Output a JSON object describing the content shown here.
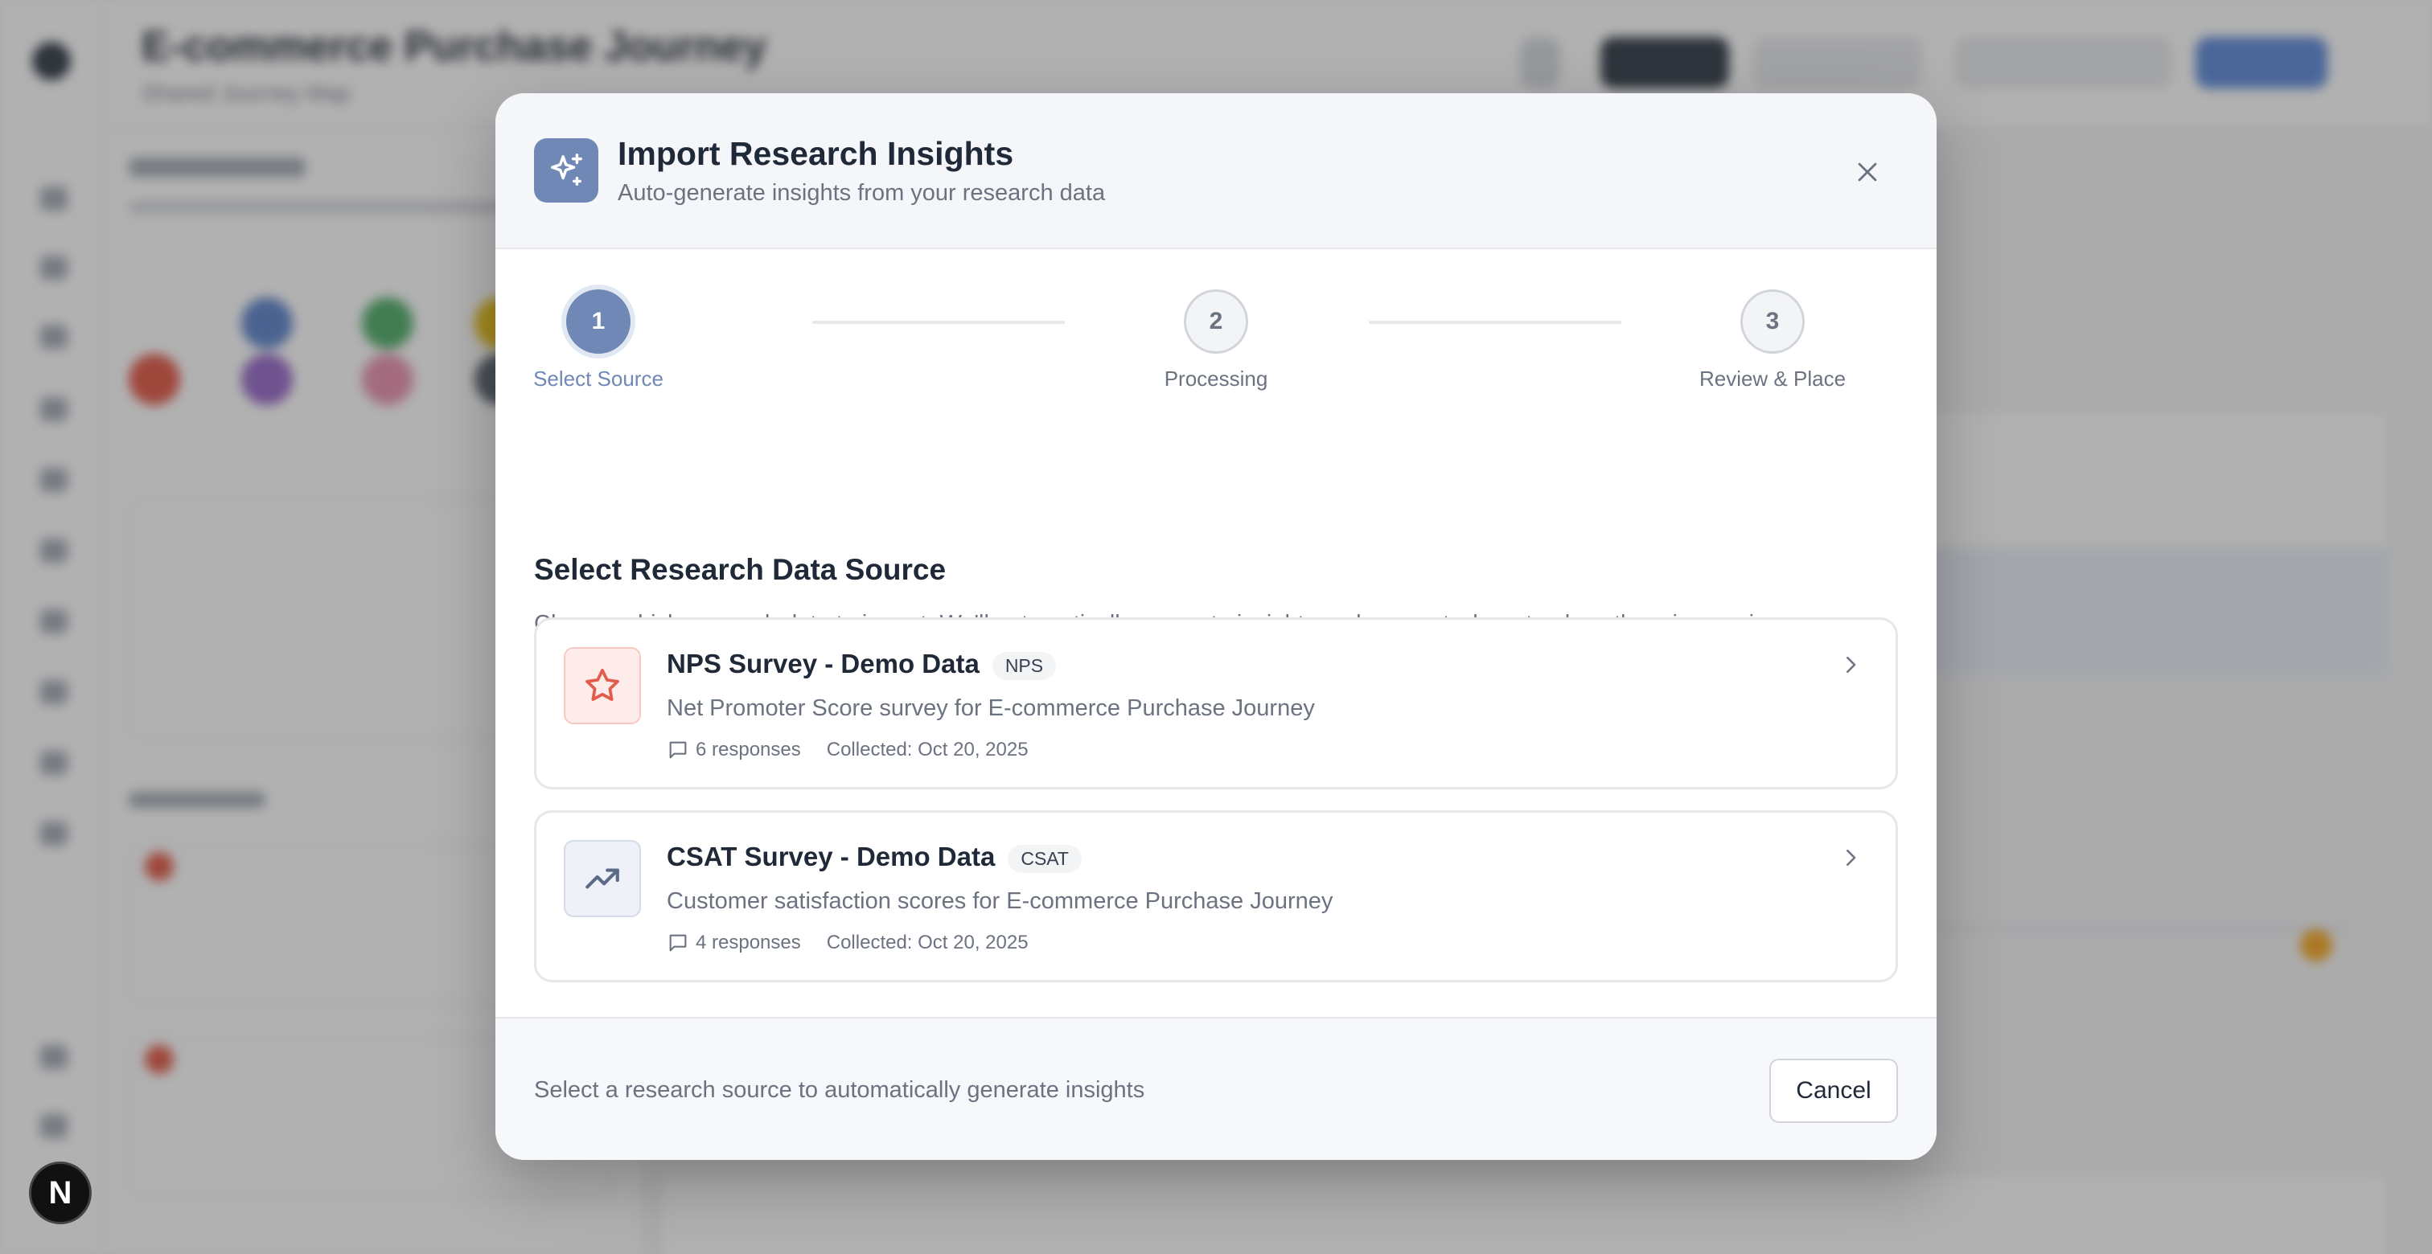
{
  "background": {
    "page_title": "E-commerce Purchase Journey",
    "page_subtitle": "Shared Journey Map"
  },
  "modal": {
    "title": "Import Research Insights",
    "subtitle": "Auto-generate insights from your research data",
    "icon": "sparkles-icon",
    "close_icon": "close-icon"
  },
  "stepper": {
    "steps": [
      {
        "number": "1",
        "label": "Select Source",
        "state": "active"
      },
      {
        "number": "2",
        "label": "Processing",
        "state": "idle"
      },
      {
        "number": "3",
        "label": "Review & Place",
        "state": "idle"
      }
    ]
  },
  "section": {
    "title": "Select Research Data Source",
    "description": "Choose which research data to import. We'll automatically generate insights and suggest where to place them in your journey map."
  },
  "sources": [
    {
      "name": "NPS Survey - Demo Data",
      "badge": "NPS",
      "description": "Net Promoter Score survey for E-commerce Purchase Journey",
      "responses": "6 responses",
      "collected": "Collected: Oct 20, 2025",
      "icon": "star-icon"
    },
    {
      "name": "CSAT Survey - Demo Data",
      "badge": "CSAT",
      "description": "Customer satisfaction scores for E-commerce Purchase Journey",
      "responses": "4 responses",
      "collected": "Collected: Oct 20, 2025",
      "icon": "trending-up-icon"
    }
  ],
  "footer": {
    "hint": "Select a research source to automatically generate insights",
    "cancel_label": "Cancel"
  },
  "dev_badge": "N",
  "colors": {
    "accent": "#7088b6",
    "nps_icon": "#e25c4b",
    "csat_icon": "#5b6b85"
  }
}
